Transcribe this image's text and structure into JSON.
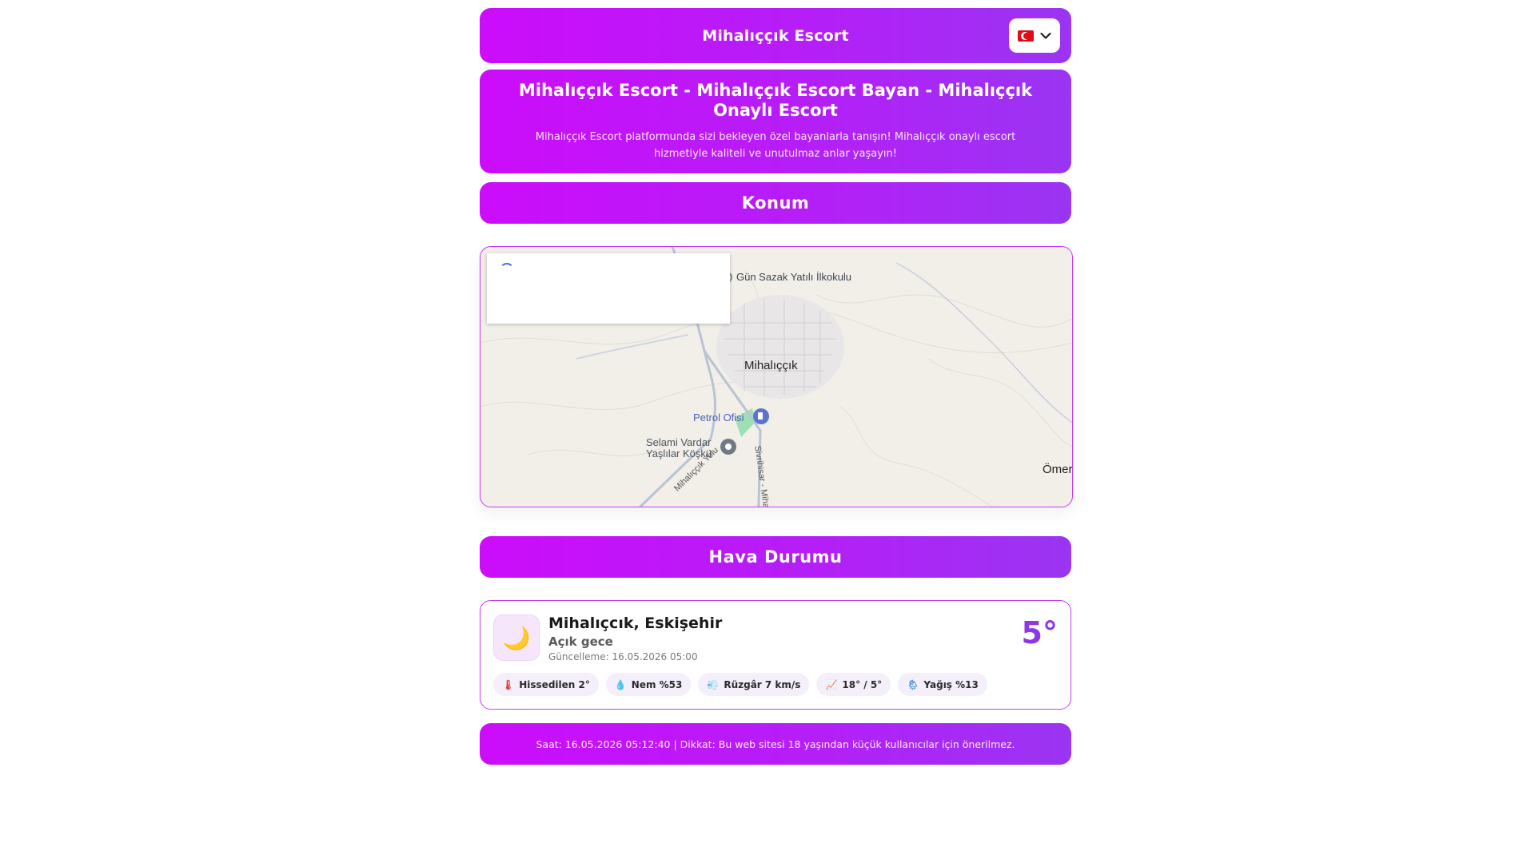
{
  "header": {
    "brand": "Mihalıççık Escort",
    "language_flag": "TR",
    "dropdown_icon": "chevron-down-icon"
  },
  "hero": {
    "title": "Mihalıççık Escort - Mihalıççık Escort Bayan - Mihalıççık Onaylı Escort",
    "description": "Mihalıççık Escort platformunda sizi bekleyen özel bayanlarla tanışın! Mihalıççık onaylı escort hizmetiyle kaliteli ve unutulmaz anlar yaşayın!"
  },
  "location": {
    "heading": "Konum",
    "map_labels": {
      "school": "Gün Sazak Yatılı İlkokulu",
      "town": "Mihalıççık",
      "fuel": "Petrol Ofisi",
      "poi": "Selami Vardar Yaşlılar Köşkü",
      "road1": "Mihalıççık Yolu",
      "road2": "Sivrihisar - Miha",
      "edge": "Ömer"
    }
  },
  "weather": {
    "heading": "Hava Durumu",
    "icon": "moon-icon",
    "city": "Mihalıçcık, Eskişehir",
    "condition": "Açık gece",
    "updated": "Güncelleme: 16.05.2026 05:00",
    "temperature": "5°",
    "chips": [
      {
        "icon": "thermometer-icon",
        "text": "Hissedilen 2°"
      },
      {
        "icon": "droplet-icon",
        "text": "Nem %53"
      },
      {
        "icon": "wind-icon",
        "text": "Rüzgâr 7 km/s"
      },
      {
        "icon": "chart-up-icon",
        "text": "18° / 5°"
      },
      {
        "icon": "rain-icon",
        "text": "Yağış %13"
      }
    ]
  },
  "footer": {
    "text": "Saat: 16.05.2026 05:12:40 | Dikkat: Bu web sitesi 18 yaşından küçük kullanıcılar için önerilmez."
  },
  "colors": {
    "gradient_start": "#cc0cfb",
    "gradient_end": "#9a35f2",
    "temperature": "#8e36e8",
    "map_bg": "#f1efe8"
  }
}
